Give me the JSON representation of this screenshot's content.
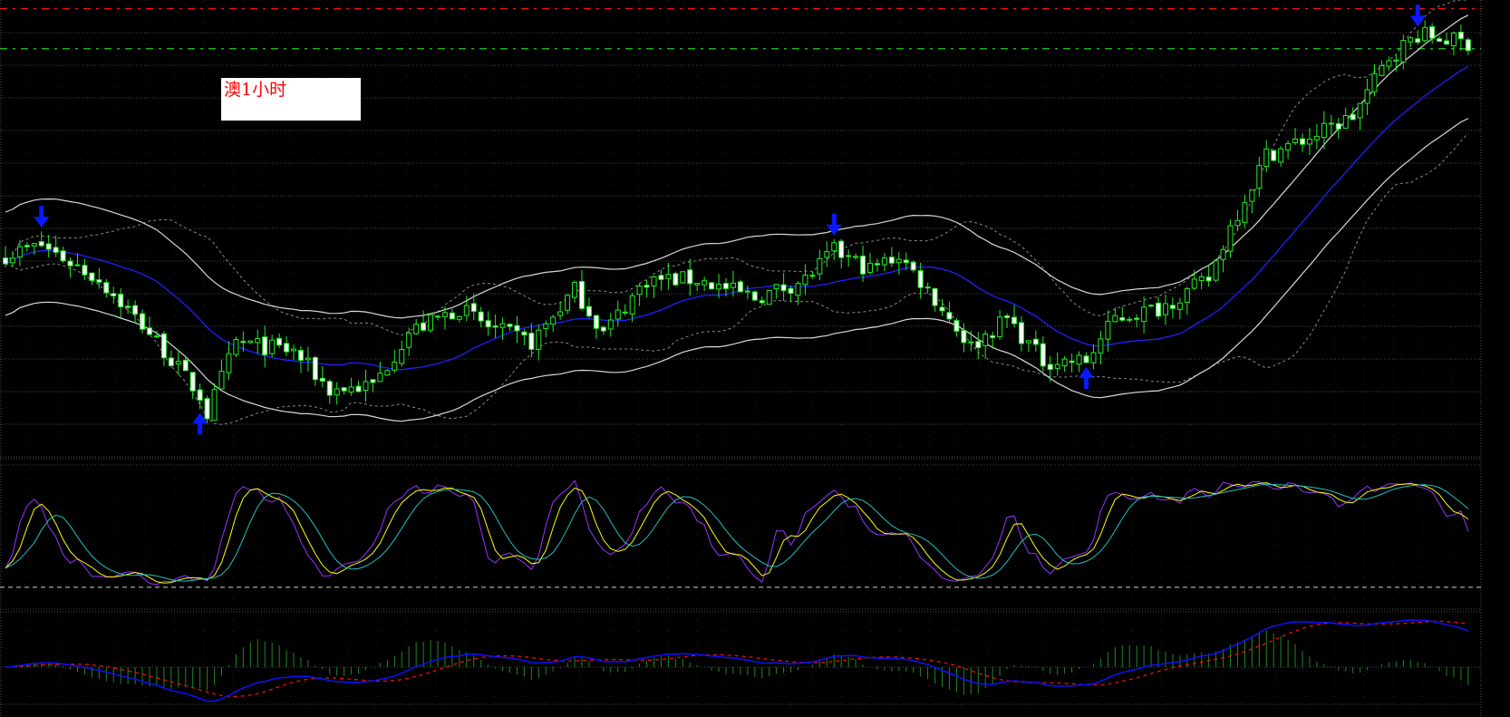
{
  "chart_label": "澳1小时",
  "colors": {
    "background": "#000000",
    "grid": "#4a4a4a",
    "candle_outline": "#22ee22",
    "candle_down_fill": "#ffffff",
    "candle_up_fill": "#000000",
    "moving_average": "#2020ff",
    "outer_band": "#d8d8d8",
    "bollinger_band": "#8a8a8a",
    "signal_arrow": "#0a1aff",
    "resistance_line": "#ff1010",
    "price_line": "#22cc22",
    "osc_fast": "#9b30ff",
    "osc_mid": "#ffff00",
    "osc_slow": "#20c0c0",
    "osc_level": "#d0d0d0",
    "macd_line": "#1010ff",
    "macd_signal": "#ff1010",
    "macd_hist": "#1e8a1e"
  },
  "chart_data": {
    "type": "candlestick",
    "candle_count": 204,
    "price_range": [
      0.92,
      0.952
    ],
    "close_anchors": [
      [
        0,
        0.9342
      ],
      [
        5,
        0.9349
      ],
      [
        13,
        0.9325
      ],
      [
        20,
        0.9288
      ],
      [
        27,
        0.9244
      ],
      [
        28,
        0.9231
      ],
      [
        32,
        0.9281
      ],
      [
        40,
        0.9275
      ],
      [
        45,
        0.9248
      ],
      [
        51,
        0.9251
      ],
      [
        56,
        0.9288
      ],
      [
        63,
        0.9305
      ],
      [
        67,
        0.9292
      ],
      [
        73,
        0.9281
      ],
      [
        79,
        0.9318
      ],
      [
        83,
        0.9288
      ],
      [
        89,
        0.9325
      ],
      [
        96,
        0.9325
      ],
      [
        104,
        0.9312
      ],
      [
        111,
        0.9325
      ],
      [
        115,
        0.9345
      ],
      [
        120,
        0.9332
      ],
      [
        124,
        0.9342
      ],
      [
        128,
        0.9318
      ],
      [
        134,
        0.9278
      ],
      [
        139,
        0.9298
      ],
      [
        144,
        0.9268
      ],
      [
        150,
        0.9268
      ],
      [
        154,
        0.9298
      ],
      [
        160,
        0.9305
      ],
      [
        167,
        0.9325
      ],
      [
        170,
        0.9362
      ],
      [
        175,
        0.9412
      ],
      [
        182,
        0.9426
      ],
      [
        187,
        0.9439
      ],
      [
        192,
        0.948
      ],
      [
        196,
        0.9496
      ],
      [
        203,
        0.949
      ]
    ],
    "horizontal_levels": {
      "resistance": 0.9514,
      "current_price": 0.9486
    },
    "signals": {
      "sell_arrows": [
        5,
        115,
        196
      ],
      "buy_arrows": [
        27,
        150
      ]
    },
    "indicators": {
      "moving_average_period": 20,
      "outer_band_offset": 0.0036,
      "bollinger_deviation": 2,
      "oscillator": {
        "range": [
          -20,
          112
        ],
        "level": 0,
        "period": 10
      },
      "macd": {
        "fast": 12,
        "slow": 26,
        "signal": 9
      }
    }
  }
}
